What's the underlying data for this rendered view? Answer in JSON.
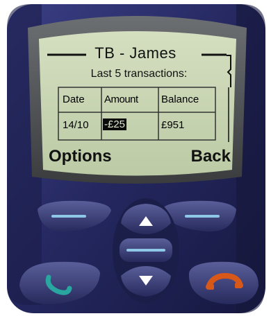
{
  "screen": {
    "title": "TB - James",
    "subtitle": "Last 5 transactions:",
    "table": {
      "headers": [
        "Date",
        "Amount",
        "Balance"
      ],
      "rows": [
        {
          "date": "14/10",
          "amount": "-£25",
          "balance": "£951"
        }
      ]
    },
    "softkeys": {
      "left": "Options",
      "right": "Back"
    }
  },
  "colors": {
    "phone_body": "#2b2f6b",
    "lcd_background": "#c9d6b6",
    "call_button": "#2aa6a0",
    "end_button": "#d8581a"
  },
  "icons": {
    "scroll_up": "triangle-up-icon",
    "scroll_down": "triangle-down-icon",
    "call": "green-phone-icon",
    "end": "red-phone-icon"
  }
}
